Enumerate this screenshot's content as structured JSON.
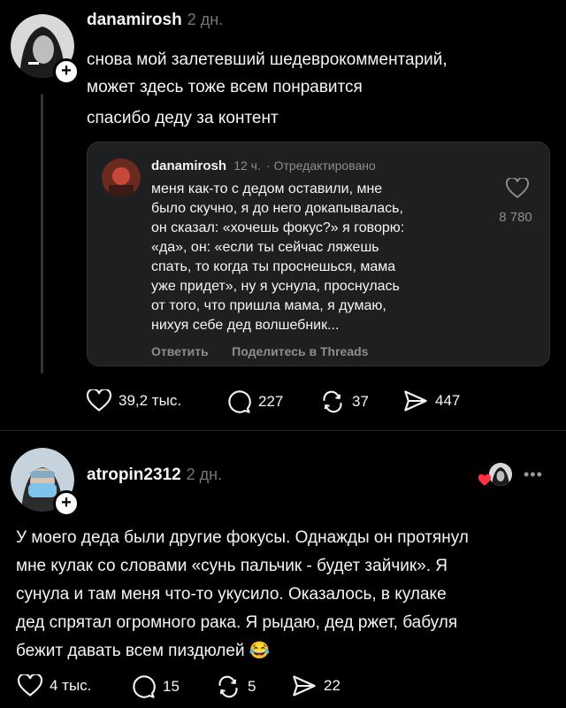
{
  "post1": {
    "username": "danamirosh",
    "time": "2 дн.",
    "lines": [
      "снова мой залетевший шедеврокомментарий,",
      "может здесь тоже всем понравится",
      "спасибо деду за контент"
    ],
    "quote": {
      "username": "danamirosh",
      "time": "12 ч.",
      "edited": "· Отредактировано",
      "lines": [
        "меня как-то с дедом оставили, мне",
        "было скучно, я до него докапывалась,",
        "он сказал: «хочешь фокус?» я говорю:",
        "«да», он: «если ты сейчас ляжешь",
        "спать, то когда ты проснешься, мама",
        "уже придет», ну я уснула, проснулась",
        "от того, что пришла мама, я думаю,",
        "нихуя себе дед волшебник..."
      ],
      "likes": "8 780",
      "reply_label": "Ответить",
      "share_label": "Поделитесь в Threads"
    },
    "stats": {
      "likes": "39,2 тыс.",
      "comments": "227",
      "reposts": "37",
      "shares": "447"
    }
  },
  "post2": {
    "username": "atropin2312",
    "time": "2 дн.",
    "lines": [
      "У моего деда были другие фокусы. Однажды он протянул",
      "мне кулак со словами «сунь пальчик - будет зайчик». Я",
      "сунула и там меня что-то укусило. Оказалось, в кулаке",
      "дед спрятал огромного рака. Я рыдаю, дед ржет, бабуля",
      "бежит давать всем пиздюлей 😂"
    ],
    "more": "•••",
    "stats": {
      "likes": "4 тыс.",
      "comments": "15",
      "reposts": "5",
      "shares": "22"
    }
  },
  "icons": [
    "plus-icon",
    "heart-icon",
    "comment-icon",
    "repost-icon",
    "share-icon",
    "more-icon"
  ],
  "colors": {
    "background": "#000000",
    "quote_bg": "#1e1f21",
    "muted": "#777777",
    "like_red": "#ff3040"
  }
}
